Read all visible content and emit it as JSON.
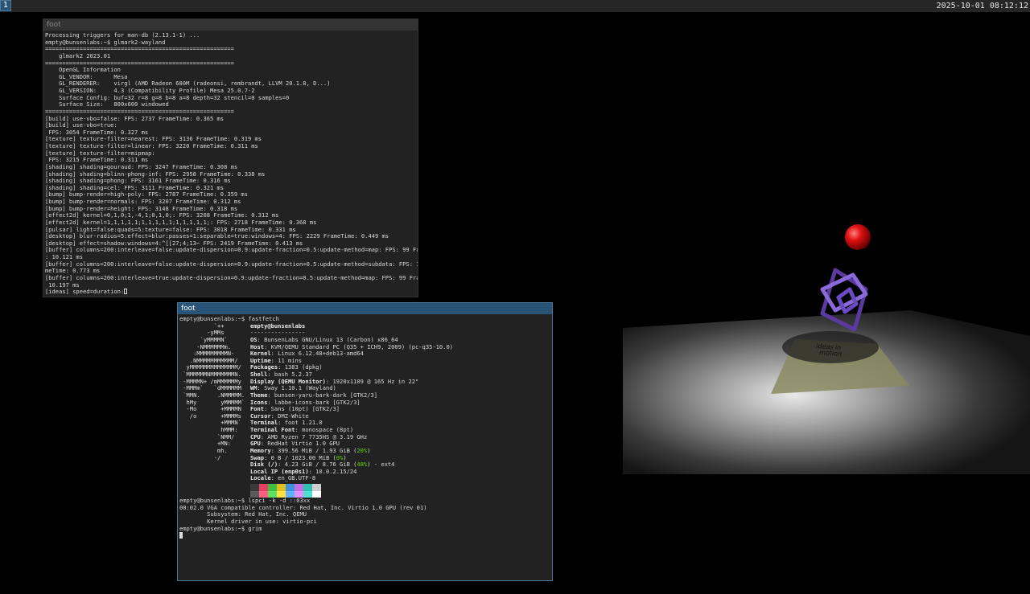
{
  "topbar": {
    "workspace": "1",
    "clock": "2025-10-01 08:12:12"
  },
  "window1": {
    "title": "foot",
    "lines": [
      "Processing triggers for man-db (2.13.1-1) ...",
      "empty@bunsenlabs:~$ glmark2-wayland",
      "=======================================================",
      "    glmark2 2023.01",
      "=======================================================",
      "    OpenGL Information",
      "    GL_VENDOR:      Mesa",
      "    GL_RENDERER:    virgl (AMD Radeon 680M (radeonsi, rembrandt, LLVM 20.1.8, D...)",
      "    GL_VERSION:     4.3 (Compatibility Profile) Mesa 25.0.7-2",
      "    Surface Config: buf=32 r=8 g=8 b=8 a=8 depth=32 stencil=0 samples=0",
      "    Surface Size:   800x600 windowed",
      "=======================================================",
      "[build] use-vbo=false: FPS: 2737 FrameTime: 0.365 ms",
      "[build] use-vbo=true:",
      " FPS: 3054 FrameTime: 0.327 ms",
      "[texture] texture-filter=nearest: FPS: 3136 FrameTime: 0.319 ms",
      "[texture] texture-filter=linear: FPS: 3220 FrameTime: 0.311 ms",
      "[texture] texture-filter=mipmap:",
      " FPS: 3215 FrameTime: 0.311 ms",
      "[shading] shading=gouraud: FPS: 3247 FrameTime: 0.308 ms",
      "[shading] shading=blinn-phong-inf: FPS: 2958 FrameTime: 0.338 ms",
      "[shading] shading=phong: FPS: 3161 FrameTime: 0.316 ms",
      "[shading] shading=cel: FPS: 3111 FrameTime: 0.321 ms",
      "[bump] bump-render=high-poly: FPS: 2787 FrameTime: 0.359 ms",
      "[bump] bump-render=normals: FPS: 3207 FrameTime: 0.312 ms",
      "[bump] bump-render=height: FPS: 3148 FrameTime: 0.318 ms",
      "[effect2d] kernel=0,1,0;1,-4,1;0,1,0;: FPS: 3208 FrameTime: 0.312 ms",
      "[effect2d] kernel=1,1,1,1,1;1,1,1,1,1;1,1,1,1,1;: FPS: 2718 FrameTime: 0.368 ms",
      "[pulsar] light=false:quads=5:texture=false: FPS: 3018 FrameTime: 0.331 ms",
      "[desktop] blur-radius=5:effect=blur:passes=1:separable=true:windows=4: FPS: 2229 FrameTime: 0.449 ms",
      "[desktop] effect=shadow:windows=4:^[[27;4;13~ FPS: 2419 FrameTime: 0.413 ms",
      "[buffer] columns=200:interleave=false:update-dispersion=0.9:update-fraction=0.5:update-method=map: FPS: 99 FrameTime",
      ": 10.121 ms",
      "[buffer] columns=200:interleave=false:update-dispersion=0.9:update-fraction=0.5:update-method=subdata: FPS: 1295 Fra",
      "meTime: 0.773 ms",
      "[buffer] columns=200:interleave=true:update-dispersion=0.9:update-fraction=0.5:update-method=map: FPS: 99 FrameTime:",
      " 10.197 ms"
    ],
    "prompt_line": "[ideas] speed=duration:"
  },
  "window2": {
    "title": "foot",
    "command1": "empty@bunsenlabs:~$ fastfetch",
    "logo": [
      "          `++",
      "        -yMMs",
      "      `yMMMMN`",
      "     -NMMMMMMm.",
      "    :MMMMMMMMMN-",
      "   .NMMMMMMMMMMM/",
      "  yMMMMMMMMMMMMMM/",
      " `MMMMMMNMMMMMMMN.",
      " -MMMMN+ /mMMMMMMy",
      " -MMMm`   `dMMMMMM",
      " `MMN.     .NMMMMM.",
      "  hMy       yMMMMM`",
      "  -Mo       +MMMMN",
      "   /o       +MMMMs",
      "            +MMMN`",
      "            hMMM:",
      "           `NMM/",
      "           +MN:",
      "           mh.",
      "          -/"
    ],
    "user_host": "empty@bunsenlabs",
    "separator": "----------------",
    "info": [
      {
        "key": "OS",
        "value": "BunsenLabs GNU/Linux 13 (Carbon) x86_64"
      },
      {
        "key": "Host",
        "value": "KVM/QEMU Standard PC (Q35 + ICH9, 2009) (pc-q35-10.0)"
      },
      {
        "key": "Kernel",
        "value": "Linux 6.12.48+deb13-amd64"
      },
      {
        "key": "Uptime",
        "value": "11 mins"
      },
      {
        "key": "Packages",
        "value": "1383 (dpkg)"
      },
      {
        "key": "Shell",
        "value": "bash 5.2.37"
      },
      {
        "key": "Display (QEMU Monitor)",
        "value": "1920x1109 @ 165 Hz in 22\""
      },
      {
        "key": "WM",
        "value": "Sway 1.10.1 (Wayland)"
      },
      {
        "key": "Theme",
        "value": "bunsen-yaru-bark-dark [GTK2/3]"
      },
      {
        "key": "Icons",
        "value": "labbe-icons-bark [GTK2/3]"
      },
      {
        "key": "Font",
        "value": "Sans (10pt) [GTK2/3]"
      },
      {
        "key": "Cursor",
        "value": "DMZ-White"
      },
      {
        "key": "Terminal",
        "value": "foot 1.21.0"
      },
      {
        "key": "Terminal Font",
        "value": "monospace (8pt)"
      },
      {
        "key": "CPU",
        "value": "AMD Ryzen 7 7735HS @ 3.19 GHz"
      },
      {
        "key": "GPU",
        "value": "RedHat Virtio 1.0 GPU"
      },
      {
        "key": "Memory",
        "value": "399.56 MiB / 1.93 GiB",
        "pct": "20%"
      },
      {
        "key": "Swap",
        "value": "0 B / 1023.00 MiB",
        "pct": "0%"
      },
      {
        "key": "Disk (/)",
        "value": "4.23 GiB / 8.76 GiB",
        "pct": "48%",
        "suffix": "- ext4"
      },
      {
        "key": "Local IP (enp0s1)",
        "value": "10.0.2.15/24"
      },
      {
        "key": "Locale",
        "value": "en_GB.UTF-8"
      }
    ],
    "swatch_colors_top": [
      "#3a3a3a",
      "#e84060",
      "#40c040",
      "#e0c020",
      "#4090e0",
      "#c070e0",
      "#30c0b0",
      "#d0d0d0"
    ],
    "swatch_colors_bottom": [
      "#5a5a5a",
      "#ff6080",
      "#60e060",
      "#ffe040",
      "#60b0ff",
      "#e090ff",
      "#50e0d0",
      "#ffffff"
    ],
    "lines_after": [
      "empty@bunsenlabs:~$ lspci -k -d ::03xx",
      "00:02.0 VGA compatible controller: Red Hat, Inc. Virtio 1.0 GPU (rev 01)",
      "        Subsystem: Red Hat, Inc. QEMU",
      "        Kernel driver in use: virtio-pci",
      "empty@bunsenlabs:~$ grim"
    ]
  },
  "scene": {
    "sign_text_1": "ideas in",
    "sign_text_2": "motion"
  }
}
